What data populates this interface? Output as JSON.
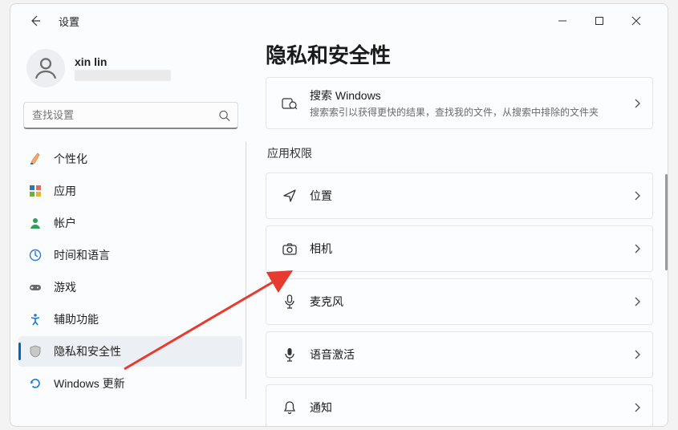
{
  "window": {
    "title": "设置"
  },
  "user": {
    "name": "xin lin"
  },
  "search": {
    "placeholder": "查找设置"
  },
  "sidebar": {
    "items": [
      {
        "label": "个性化"
      },
      {
        "label": "应用"
      },
      {
        "label": "帐户"
      },
      {
        "label": "时间和语言"
      },
      {
        "label": "游戏"
      },
      {
        "label": "辅助功能"
      },
      {
        "label": "隐私和安全性",
        "selected": true
      },
      {
        "label": "Windows 更新"
      }
    ]
  },
  "page": {
    "title": "隐私和安全性"
  },
  "search_card": {
    "title": "搜索 Windows",
    "subtitle": "搜索索引以获得更快的结果，查找我的文件，从搜索中排除的文件夹"
  },
  "section_label": "应用权限",
  "permissions": [
    {
      "label": "位置"
    },
    {
      "label": "相机"
    },
    {
      "label": "麦克风"
    },
    {
      "label": "语音激活"
    },
    {
      "label": "通知"
    }
  ]
}
